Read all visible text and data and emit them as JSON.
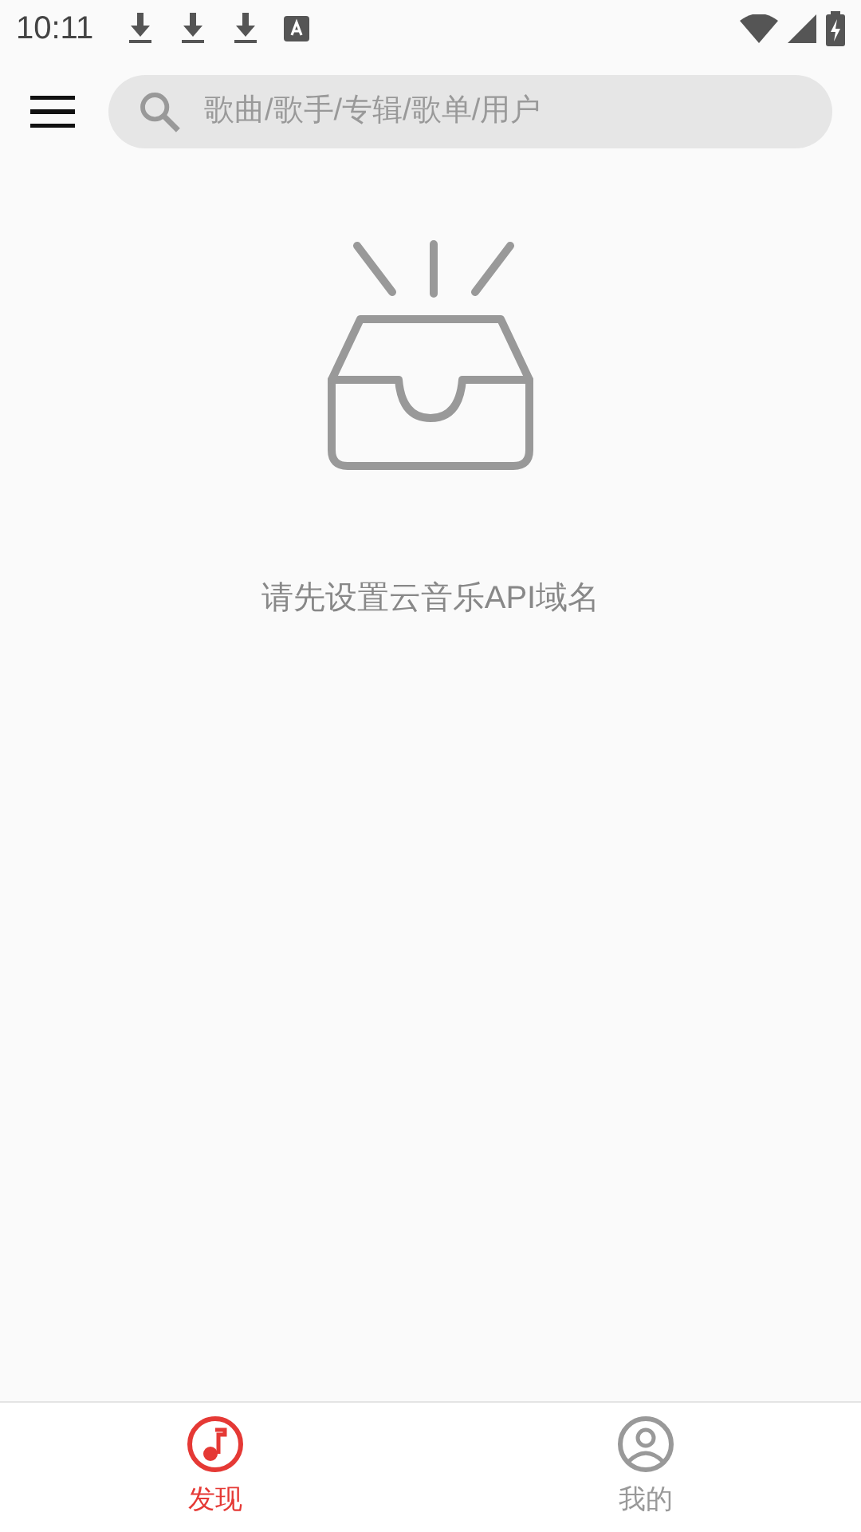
{
  "status_bar": {
    "time": "10:11"
  },
  "search": {
    "placeholder": "歌曲/歌手/专辑/歌单/用户"
  },
  "empty_state": {
    "message": "请先设置云音乐API域名"
  },
  "bottom_nav": [
    {
      "label": "发现",
      "kind": "music",
      "selected": true
    },
    {
      "label": "我的",
      "kind": "person",
      "selected": false
    }
  ]
}
